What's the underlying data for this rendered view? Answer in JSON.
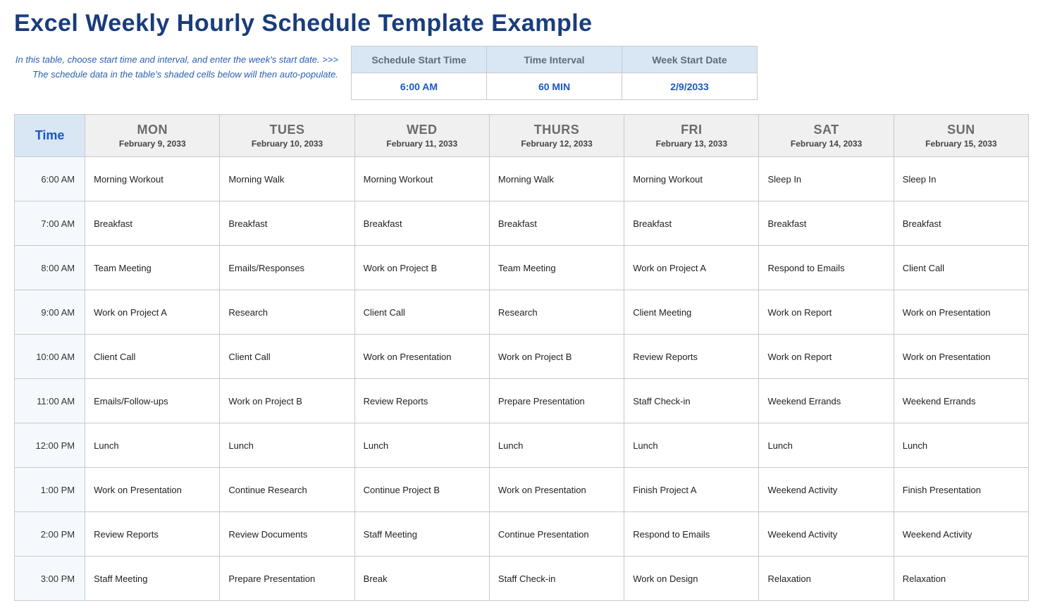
{
  "title": "Excel Weekly Hourly Schedule Template Example",
  "instructions_line1": "In this table, choose start time and interval, and enter the week's start date. >>>",
  "instructions_line2": "The schedule data in the table's shaded cells below will then auto-populate.",
  "settings": {
    "headers": [
      "Schedule Start Time",
      "Time Interval",
      "Week Start Date"
    ],
    "values": [
      "6:00 AM",
      "60 MIN",
      "2/9/2033"
    ]
  },
  "schedule": {
    "time_header": "Time",
    "days": [
      {
        "name": "MON",
        "date": "February 9, 2033"
      },
      {
        "name": "TUES",
        "date": "February 10, 2033"
      },
      {
        "name": "WED",
        "date": "February 11, 2033"
      },
      {
        "name": "THURS",
        "date": "February 12, 2033"
      },
      {
        "name": "FRI",
        "date": "February 13, 2033"
      },
      {
        "name": "SAT",
        "date": "February 14, 2033"
      },
      {
        "name": "SUN",
        "date": "February 15, 2033"
      }
    ],
    "rows": [
      {
        "time": "6:00 AM",
        "cells": [
          "Morning Workout",
          "Morning Walk",
          "Morning Workout",
          "Morning Walk",
          "Morning Workout",
          "Sleep In",
          "Sleep In"
        ]
      },
      {
        "time": "7:00 AM",
        "cells": [
          "Breakfast",
          "Breakfast",
          "Breakfast",
          "Breakfast",
          "Breakfast",
          "Breakfast",
          "Breakfast"
        ]
      },
      {
        "time": "8:00 AM",
        "cells": [
          "Team Meeting",
          "Emails/Responses",
          "Work on Project B",
          "Team Meeting",
          "Work on Project A",
          "Respond to Emails",
          "Client Call"
        ]
      },
      {
        "time": "9:00 AM",
        "cells": [
          "Work on Project A",
          "Research",
          "Client Call",
          "Research",
          "Client Meeting",
          "Work on Report",
          "Work on Presentation"
        ]
      },
      {
        "time": "10:00 AM",
        "cells": [
          "Client Call",
          "Client Call",
          "Work on Presentation",
          "Work on Project B",
          "Review Reports",
          "Work on Report",
          "Work on Presentation"
        ]
      },
      {
        "time": "11:00 AM",
        "cells": [
          "Emails/Follow-ups",
          "Work on Project B",
          "Review Reports",
          "Prepare Presentation",
          "Staff Check-in",
          "Weekend Errands",
          "Weekend Errands"
        ]
      },
      {
        "time": "12:00 PM",
        "cells": [
          "Lunch",
          "Lunch",
          "Lunch",
          "Lunch",
          "Lunch",
          "Lunch",
          "Lunch"
        ]
      },
      {
        "time": "1:00 PM",
        "cells": [
          "Work on Presentation",
          "Continue Research",
          "Continue Project B",
          "Work on Presentation",
          "Finish Project A",
          "Weekend Activity",
          "Finish Presentation"
        ]
      },
      {
        "time": "2:00 PM",
        "cells": [
          "Review Reports",
          "Review Documents",
          "Staff Meeting",
          "Continue Presentation",
          "Respond to Emails",
          "Weekend Activity",
          "Weekend Activity"
        ]
      },
      {
        "time": "3:00 PM",
        "cells": [
          "Staff Meeting",
          "Prepare Presentation",
          "Break",
          "Staff Check-in",
          "Work on Design",
          "Relaxation",
          "Relaxation"
        ]
      }
    ]
  }
}
